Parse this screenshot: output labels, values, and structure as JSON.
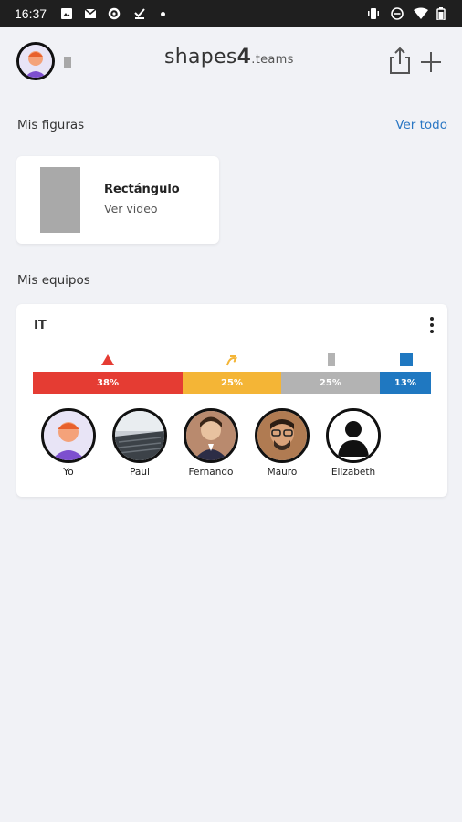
{
  "status_bar": {
    "time": "16:37",
    "left_icons": [
      "image-icon",
      "gmail-icon",
      "settings-icon",
      "download-done-icon",
      "dot-icon"
    ],
    "right_icons": [
      "vibrate-icon",
      "do-not-disturb-icon",
      "wifi-icon",
      "battery-icon"
    ]
  },
  "header": {
    "logo_prefix": "shapes",
    "logo_number": "4",
    "logo_suffix": ".teams",
    "share_icon": "share-icon",
    "add_icon": "plus-icon"
  },
  "figures": {
    "title": "Mis figuras",
    "see_all": "Ver todo",
    "card": {
      "name": "Rectángulo",
      "subtitle": "Ver video"
    }
  },
  "teams": {
    "title": "Mis equipos",
    "team": {
      "name": "IT",
      "distribution": [
        {
          "shape": "triangle",
          "label": "38%",
          "value": 0.38,
          "color": "#e53c33"
        },
        {
          "shape": "squiggle",
          "label": "25%",
          "value": 0.25,
          "color": "#f4b536"
        },
        {
          "shape": "rectangle",
          "label": "25%",
          "value": 0.25,
          "color": "#b3b3b3"
        },
        {
          "shape": "square",
          "label": "13%",
          "value": 0.13,
          "color": "#1f78c1"
        }
      ],
      "members": [
        {
          "name": "Yo"
        },
        {
          "name": "Paul"
        },
        {
          "name": "Fernando"
        },
        {
          "name": "Mauro"
        },
        {
          "name": "Elizabeth"
        }
      ]
    }
  }
}
